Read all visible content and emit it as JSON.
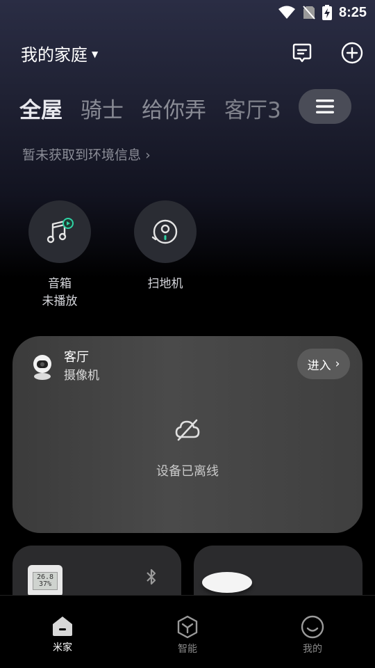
{
  "status_bar": {
    "time": "8:25"
  },
  "header": {
    "home_name": "我的家庭"
  },
  "tabs": [
    "全屋",
    "骑士",
    "给你弄",
    "客厅3"
  ],
  "environment": {
    "text": "暂未获取到环境信息"
  },
  "quick_devices": [
    {
      "label_line1": "音箱",
      "label_line2": "未播放",
      "icon": "music-note-icon"
    },
    {
      "label_line1": "扫地机",
      "label_line2": "",
      "icon": "vacuum-robot-icon"
    }
  ],
  "camera_card": {
    "room": "客厅",
    "device": "摄像机",
    "enter_label": "进入",
    "status": "设备已离线"
  },
  "sensor_card": {
    "display_value": "26.8",
    "display_sub": "37%"
  },
  "bottom_nav": [
    {
      "label": "米家",
      "icon": "home-icon",
      "active": true
    },
    {
      "label": "智能",
      "icon": "smart-cube-icon",
      "active": false
    },
    {
      "label": "我的",
      "icon": "profile-icon",
      "active": false
    }
  ],
  "colors": {
    "background": "#000000",
    "card": "#444444",
    "tab_inactive": "#8a8c96"
  }
}
